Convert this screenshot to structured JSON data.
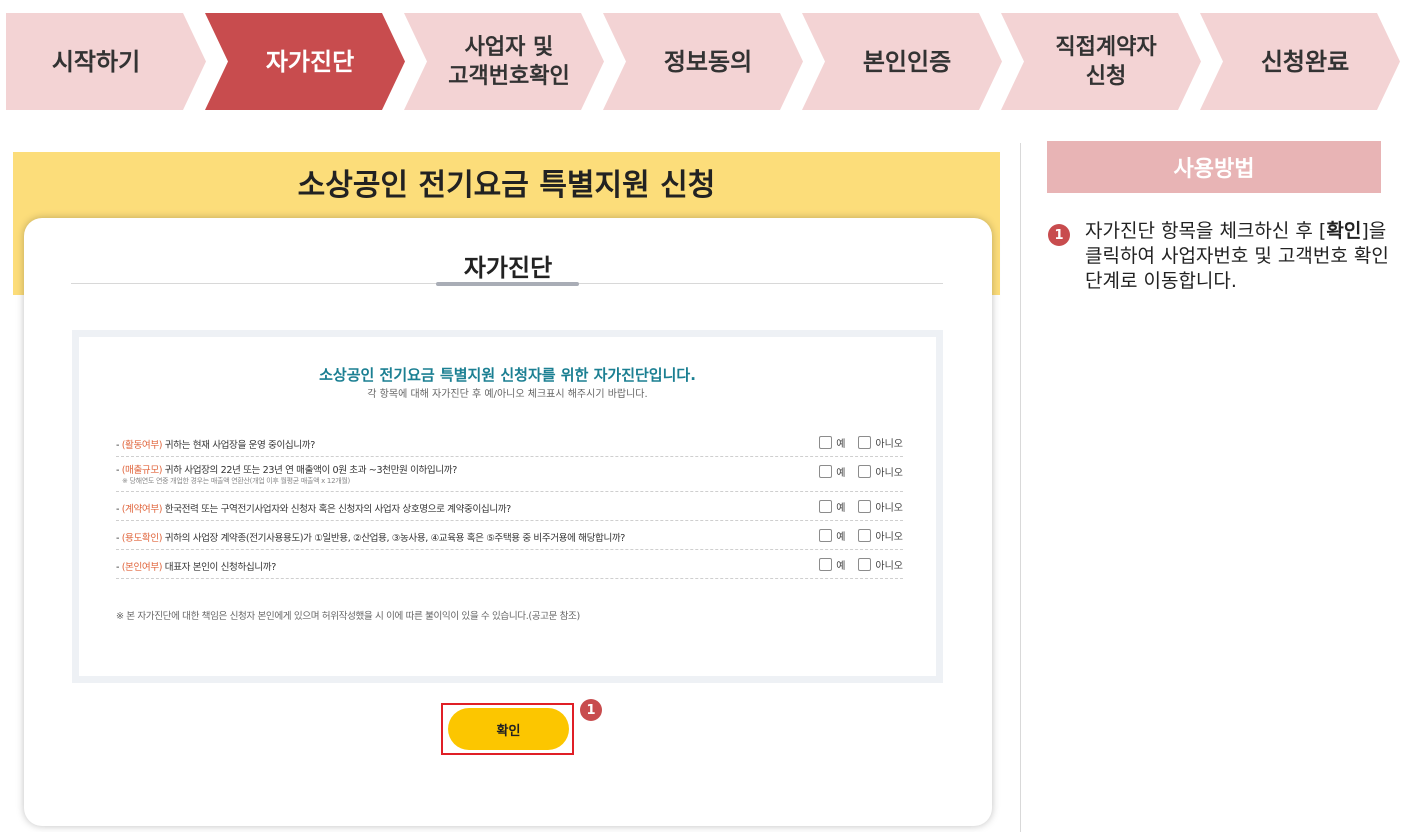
{
  "steps": [
    {
      "label": "시작하기",
      "active": false
    },
    {
      "label": "자가진단",
      "active": true
    },
    {
      "label_line1": "사업자 및",
      "label_line2": "고객번호확인",
      "active": false
    },
    {
      "label": "정보동의",
      "active": false
    },
    {
      "label": "본인인증",
      "active": false
    },
    {
      "label_line1": "직접계약자",
      "label_line2": "신청",
      "active": false
    },
    {
      "label": "신청완료",
      "active": false
    }
  ],
  "main": {
    "title": "소상공인 전기요금 특별지원 신청",
    "card_title": "자가진단",
    "survey": {
      "heading": "소상공인 전기요금 특별지원 신청자를 위한 자가진단입니다.",
      "subheading": "각 항목에 대해 자가진단 후 예/아니오 체크표시 해주시기 바랍니다.",
      "yes_label": "예",
      "no_label": "아니오",
      "questions": [
        {
          "prefix": "- ",
          "tag": "(활동여부)",
          "text": " 귀하는 현재 사업장을 운영 중이십니까?"
        },
        {
          "prefix": "- ",
          "tag": "(매출규모)",
          "text": " 귀하 사업장의 22년 또는 23년 연 매출액이 0원 초과 ~3천만원 이하입니까?",
          "note": "※ 당해연도 연중 개업한 경우는 매출액 연환산(개업 이후 월평균 매출액 x 12개월)"
        },
        {
          "prefix": "- ",
          "tag": "(계약여부)",
          "text": " 한국전력 또는 구역전기사업자와 신청자 혹은 신청자의 사업자 상호명으로 계약중이십니까?"
        },
        {
          "prefix": "- ",
          "tag": "(용도확인)",
          "text": " 귀하의 사업장 계약종(전기사용용도)가 ①일반용, ②산업용, ③농사용, ④교육용 혹은 ⑤주택용 중 비주거용에 해당합니까?"
        },
        {
          "prefix": "- ",
          "tag": "(본인여부)",
          "text": " 대표자 본인이 신청하십니까?"
        }
      ],
      "notice": "※ 본 자가진단에 대한 책임은 신청자 본인에게 있으며 허위작성했을 시 이에 따른 불이익이 있을 수 있습니다.(공고문 참조)"
    },
    "confirm_label": "확인",
    "badge": "1"
  },
  "sidebar": {
    "usage_title": "사용방법",
    "badge": "1",
    "text_before": "자가진단 항목을 체크하신 후 [",
    "text_bold": "확인",
    "text_after": "]을 클릭하여 사업자번호 및 고객번호 확인 단계로 이동합니다."
  },
  "colors": {
    "active_step": "#c84c4e",
    "inactive_step": "#f3d3d4",
    "yellow_band": "#fcdd7a",
    "confirm_button": "#fcc600",
    "highlight_border": "#e01f26",
    "survey_heading": "#1b7f92",
    "question_tag": "#e0653c",
    "usage_title_bg": "#e8b4b5"
  }
}
